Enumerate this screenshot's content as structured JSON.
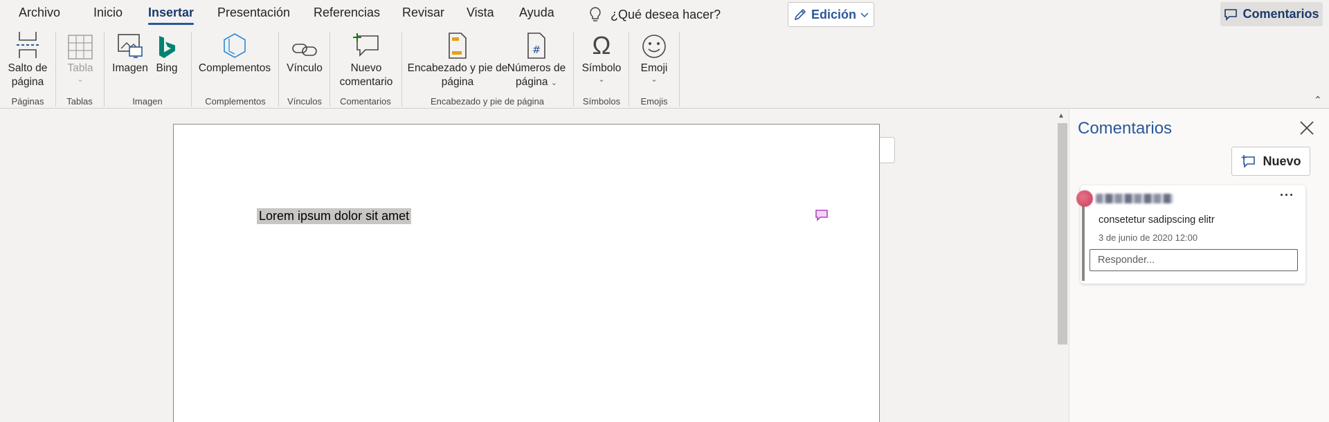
{
  "menu": {
    "tabs": [
      {
        "label": "Archivo"
      },
      {
        "label": "Inicio"
      },
      {
        "label": "Insertar"
      },
      {
        "label": "Presentación"
      },
      {
        "label": "Referencias"
      },
      {
        "label": "Revisar"
      },
      {
        "label": "Vista"
      },
      {
        "label": "Ayuda"
      }
    ],
    "active_tab": "Insertar",
    "tell_me": "¿Qué desea hacer?",
    "editing_label": "Edición",
    "comments_label": "Comentarios"
  },
  "ribbon": {
    "buttons": {
      "page_break": {
        "line1": "Salto de",
        "line2": "página"
      },
      "table": {
        "label": "Tabla"
      },
      "image": {
        "label": "Imagen"
      },
      "bing": {
        "label": "Bing"
      },
      "addins": {
        "label": "Complementos"
      },
      "link": {
        "label": "Vínculo"
      },
      "new_comment": {
        "line1": "Nuevo",
        "line2": "comentario"
      },
      "header_footer": {
        "line1": "Encabezado y pie de",
        "line2": "página"
      },
      "page_numbers": {
        "line1": "Números de",
        "line2": "página"
      },
      "symbol": {
        "label": "Símbolo"
      },
      "emoji": {
        "label": "Emoji"
      }
    },
    "groups": {
      "pages": "Páginas",
      "tables": "Tablas",
      "image": "Imagen",
      "addins": "Complementos",
      "links": "Vínculos",
      "comments": "Comentarios",
      "header_footer": "Encabezado y pie de página",
      "symbols": "Símbolos",
      "emojis": "Emojis"
    }
  },
  "document": {
    "text": "Lorem ipsum dolor sit amet"
  },
  "comments_pane": {
    "title": "Comentarios",
    "new_label": "Nuevo",
    "comment": {
      "text": "consetetur sadipscing elitr",
      "date": "3 de junio de 2020 12:00",
      "reply_placeholder": "Responder..."
    }
  },
  "colors": {
    "accent": "#2b579a",
    "ribbon_bg": "#f3f2f1",
    "comment_mark": "#b146c2"
  }
}
